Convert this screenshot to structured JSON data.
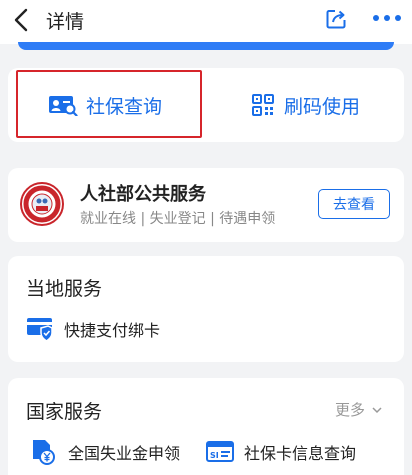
{
  "nav": {
    "title": "详情",
    "back_icon": "chevron-left-icon",
    "share_icon": "share-icon",
    "more_icon": "more-dots-icon"
  },
  "top_actions": {
    "social_query": {
      "label": "社保查询",
      "icon": "id-card-search-icon"
    },
    "scan_code": {
      "label": "刷码使用",
      "icon": "qr-code-icon"
    }
  },
  "public_service": {
    "title": "人社部公共服务",
    "subtitle": "就业在线 | 失业登记 | 待遇申领",
    "button_label": "去查看",
    "emblem_icon": "ministry-emblem-icon"
  },
  "local_services": {
    "title": "当地服务",
    "items": [
      {
        "label": "快捷支付绑卡",
        "icon": "card-shield-icon"
      }
    ]
  },
  "national_services": {
    "title": "国家服务",
    "more_label": "更多",
    "items": [
      {
        "label": "全国失业金申领",
        "icon": "yuan-document-icon"
      },
      {
        "label": "社保卡信息查询",
        "icon": "si-card-icon"
      }
    ]
  },
  "colors": {
    "accent": "#1a6ee8",
    "highlight": "#d6252b",
    "background": "#f2f3f5"
  }
}
